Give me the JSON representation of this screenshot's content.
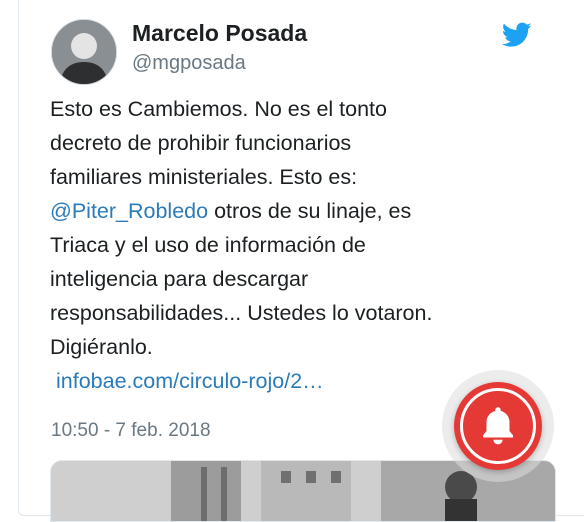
{
  "tweet": {
    "author_name": "Marcelo Posada",
    "handle": "@mgposada",
    "text_lines": [
      "Esto es Cambiemos. No es el tonto",
      "decreto de prohibir funcionarios",
      "familiares ministeriales. Esto es:"
    ],
    "mention": "@Piter_Robledo",
    "line4_rest": " otros de su linaje, es",
    "text_lines_after": [
      "Triaca y el uso de información de",
      "inteligencia para descargar",
      "responsabilidades... Ustedes lo votaron.",
      "Digiéranlo."
    ],
    "link": "infobae.com/circulo-rojo/2…",
    "timestamp": "10:50 - 7 feb. 2018"
  },
  "icons": {
    "brand": "twitter-bird-icon",
    "notification": "bell-icon"
  },
  "colors": {
    "link": "#2b7bb9",
    "secondary_text": "#697882",
    "twitter_blue": "#1da1f2",
    "bell_red": "#e53935"
  }
}
